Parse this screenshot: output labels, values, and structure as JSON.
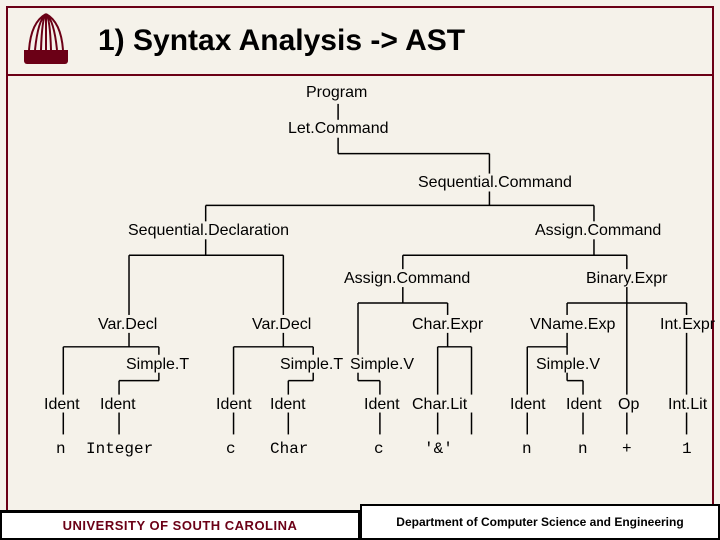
{
  "title": "1) Syntax Analysis -> AST",
  "footer": {
    "left": "UNIVERSITY OF SOUTH CAROLINA",
    "right": "Department of Computer Science and Engineering"
  },
  "nodes": {
    "program": "Program",
    "letcommand": "Let.Command",
    "seqcommand": "Sequential.Command",
    "seqdecl": "Sequential.Declaration",
    "assigncmd1": "Assign.Command",
    "assigncmd2": "Assign.Command",
    "binaryexpr": "Binary.Expr",
    "vardecl1": "Var.Decl",
    "vardecl2": "Var.Decl",
    "charexpr": "Char.Expr",
    "vnameexp": "VName.Exp",
    "intexpr": "Int.Expr",
    "simplet1": "Simple.T",
    "simplet2": "Simple.T",
    "simplev1": "Simple.V",
    "simplev2": "Simple.V",
    "ident_l0": "Ident",
    "ident_l1": "Ident",
    "ident_l2": "Ident",
    "ident_l3": "Ident",
    "ident_l4": "Ident",
    "charlit_l": "Char.Lit",
    "ident_l5": "Ident",
    "ident_l6": "Ident",
    "op_l": "Op",
    "intlit_l": "Int.Lit",
    "leaf_n": "n",
    "leaf_integer": "Integer",
    "leaf_c1": "c",
    "leaf_char": "Char",
    "leaf_c2": "c",
    "leaf_amp": "'&'",
    "leaf_n2": "n",
    "leaf_n3": "n",
    "leaf_plus": "+",
    "leaf_1": "1"
  }
}
